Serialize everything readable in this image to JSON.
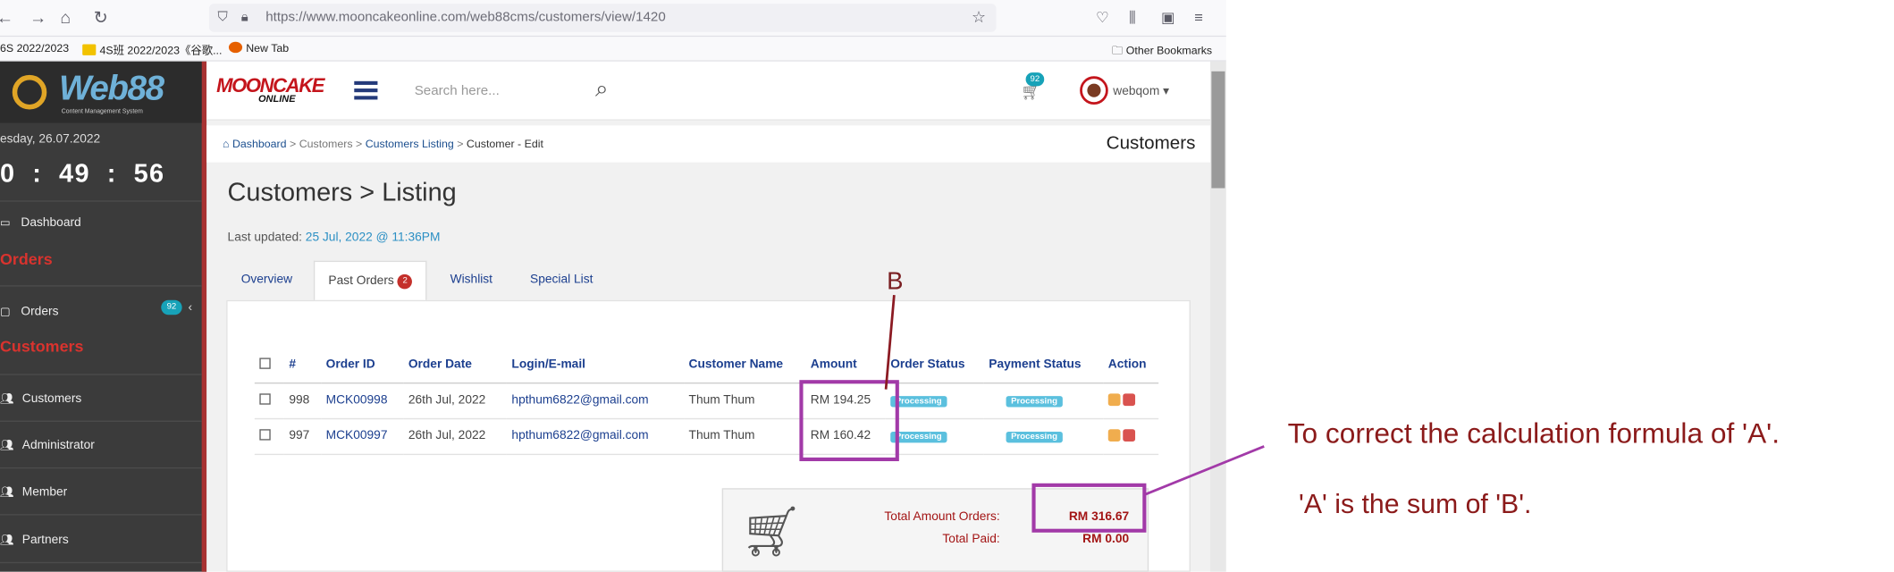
{
  "browser": {
    "url": "https://www.mooncakeonline.com/web88cms/customers/view/1420",
    "nav_icons": [
      "back-icon",
      "forward-icon",
      "home-icon",
      "reload-icon"
    ],
    "bookmarks": [
      {
        "label": "6S 2022/2023"
      },
      {
        "label": "4S班 2022/2023《谷歌..."
      },
      {
        "label": "New Tab"
      }
    ],
    "other_bookmarks": "Other Bookmarks"
  },
  "sidebar": {
    "logo": "Web88",
    "logo_sub": "Content Management System",
    "date": "esday, 26.07.2022",
    "clock": "0  :  49  :  56",
    "dashboard": "Dashboard",
    "section_orders": "Orders",
    "orders": "Orders",
    "orders_badge": "92",
    "section_customers": "Customers",
    "items": [
      "Customers",
      "Administrator",
      "Member",
      "Partners"
    ]
  },
  "topbar": {
    "brand": "MOONCAKE",
    "brand_sub": "ONLINE",
    "search_placeholder": "Search here...",
    "cart_badge": "92",
    "username": "webqom"
  },
  "breadcrumb": {
    "dashboard": "Dashboard",
    "customers": "Customers",
    "listing": "Customers Listing",
    "current": "Customer - Edit",
    "title": "Customers"
  },
  "page": {
    "title": "Customers > Listing",
    "updated_label": "Last updated: ",
    "updated_value": "25 Jul, 2022 @ 11:36PM",
    "tabs": [
      {
        "label": "Overview"
      },
      {
        "label": "Past Orders",
        "badge": "2"
      },
      {
        "label": "Wishlist"
      },
      {
        "label": "Special List"
      }
    ]
  },
  "orders_table": {
    "headers": [
      "#",
      "Order ID",
      "Order Date",
      "Login/E-mail",
      "Customer Name",
      "Amount",
      "Order Status",
      "Payment Status",
      "Action"
    ],
    "rows": [
      {
        "num": "998",
        "id": "MCK00998",
        "date": "26th Jul, 2022",
        "email": "hpthum6822@gmail.com",
        "name": "Thum Thum",
        "amount": "RM 194.25",
        "order_status": "Processing",
        "payment_status": "Processing"
      },
      {
        "num": "997",
        "id": "MCK00997",
        "date": "26th Jul, 2022",
        "email": "hpthum6822@gmail.com",
        "name": "Thum Thum",
        "amount": "RM 160.42",
        "order_status": "Processing",
        "payment_status": "Processing"
      }
    ]
  },
  "summary": {
    "total_orders_label": "Total Amount Orders:",
    "total_orders_value": "RM 316.67",
    "total_paid_label": "Total Paid:",
    "total_paid_value": "RM 0.00"
  },
  "annotation": {
    "marker": "B",
    "line1": "To correct the calculation formula of 'A'.",
    "line2": "'A' is the sum of 'B'."
  },
  "colors": {
    "accent_red": "#c4151c",
    "annotation": "#a23aa8",
    "link": "#1c3f8f",
    "badge": "#17a2b8"
  }
}
